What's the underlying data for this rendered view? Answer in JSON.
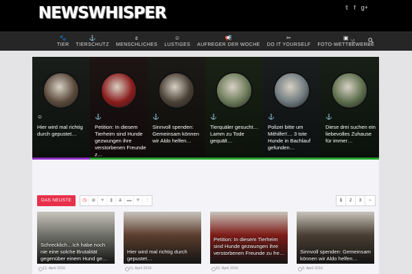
{
  "header": {
    "logo": "NEWSWHISPER",
    "social": [
      "𝕥",
      "f",
      "g+"
    ]
  },
  "nav": {
    "items": [
      {
        "icon": "🐾",
        "label": "TIER"
      },
      {
        "icon": "⚓",
        "label": "TIERSCHUTZ"
      },
      {
        "icon": "ɛ",
        "label": "MENSCHLICHES"
      },
      {
        "icon": "☺",
        "label": "LUSTIGES"
      },
      {
        "icon": "📢",
        "label": "AUFREGER DER WOCHE"
      },
      {
        "icon": "✂",
        "label": "DO IT YOURSELF"
      },
      {
        "icon": "▣",
        "label": "FOTO-WETTBEWERBE"
      }
    ],
    "shuffle_icon": "⤨"
  },
  "slider": {
    "slides": [
      {
        "cat_icon": "☺",
        "title": "Hier wird mal richtig durch gepustet…",
        "color": "#5a4a3c"
      },
      {
        "cat_icon": "⚓",
        "title": "Petition: In diesem Tierheim sind Hunde gezwungen ihre verstorbenen Freunde z…",
        "color": "#8a1c1c"
      },
      {
        "cat_icon": "⚓",
        "title": "Sinnvoll spenden: Gemeinsam können wir Aldo helfen…",
        "color": "#4a4036"
      },
      {
        "cat_icon": "⚓",
        "title": "Tierquäler gesucht… Lamm zu Tode gequält…",
        "color": "#6b7a58"
      },
      {
        "cat_icon": "⚓",
        "title": "Polizei bitte um Mithilfe!!… 3 tote Hunde in Bachlauf gefunden…",
        "color": "#6e7a7e"
      },
      {
        "cat_icon": "⚓",
        "title": "Diese drei suchen ein liebevolles Zuhause für immer…",
        "color": "#5c6e4c"
      }
    ]
  },
  "tabs": {
    "active_label": "DAS NEUSTE",
    "icons": [
      "◷",
      "◉",
      "♥",
      "▮",
      "♟",
      "▬",
      "▼",
      "⋮"
    ]
  },
  "pager": {
    "pages": [
      "1",
      "2",
      "3",
      "»"
    ]
  },
  "cards": [
    {
      "title": "Schrecklich…Ich habe noch nie eine solche Brutalität gegenüber einem Hund ge…",
      "date": "12. April 2016",
      "color": "#6d6f66"
    },
    {
      "title": "Hier wird mal richtig durch gepustet…",
      "date": "11. April 2016",
      "color": "#5c3e2e"
    },
    {
      "title": "Petition: In diesem Tierheim sind Hunde gezwungen ihre verstorbenen Freunde zu fre…",
      "date": "10. April 2016",
      "color": "#7e1c18"
    },
    {
      "title": "Sinnvoll spenden: Gemeinsam können wir Aldo helfen…",
      "date": "9. April 2016",
      "color": "#4a3e34"
    }
  ]
}
